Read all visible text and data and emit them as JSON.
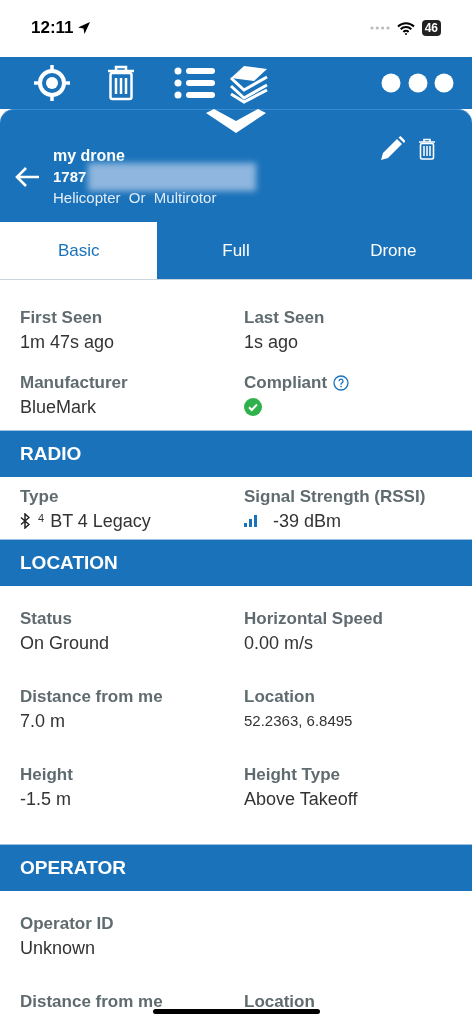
{
  "status_bar": {
    "time": "12:11",
    "battery": "46"
  },
  "header": {
    "name": "my drone",
    "id": "1787",
    "type": "Helicopter  Or  Multirotor"
  },
  "tabs": [
    {
      "label": "Basic",
      "selected": true
    },
    {
      "label": "Full",
      "selected": false
    },
    {
      "label": "Drone",
      "selected": false
    }
  ],
  "sections": [
    {
      "rows": [
        [
          {
            "label": "First Seen",
            "value": "1m 47s ago"
          },
          {
            "label": "Last Seen",
            "value": "1s ago"
          }
        ],
        [
          {
            "label": "Manufacturer",
            "value": "BlueMark"
          },
          {
            "label": "Compliant",
            "kind": "compliance",
            "compliant": true
          }
        ]
      ]
    },
    {
      "title": "RADIO",
      "rows": [
        [
          {
            "label": "Type",
            "kind": "bluetooth",
            "prefix": "4",
            "value": "BT 4 Legacy"
          },
          {
            "label": "Signal Strength (RSSI)",
            "kind": "signal",
            "value": "-39 dBm"
          }
        ]
      ]
    },
    {
      "title": "LOCATION",
      "rows": [
        [
          {
            "label": "Status",
            "value": "On Ground"
          },
          {
            "label": "Horizontal Speed",
            "value": "0.00 m/s"
          }
        ],
        [
          {
            "label": "Distance from me",
            "value": "7.0 m"
          },
          {
            "label": "Location",
            "kind": "small",
            "value": "52.2363, 6.8495"
          }
        ],
        [
          {
            "label": "Height",
            "value": "-1.5 m"
          },
          {
            "label": "Height Type",
            "value": "Above Takeoff"
          }
        ]
      ]
    },
    {
      "title": "OPERATOR",
      "rows": [
        [
          {
            "label": "Operator ID",
            "value": "Unknown"
          }
        ],
        [
          {
            "label": "Distance from me"
          },
          {
            "label": "Location"
          }
        ]
      ]
    }
  ]
}
